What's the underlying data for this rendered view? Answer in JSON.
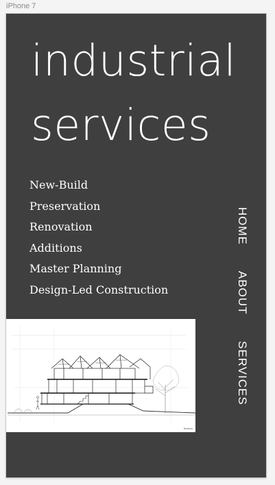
{
  "artboard": {
    "label": "iPhone 7"
  },
  "hero": {
    "line1": "industrial",
    "line2": "services"
  },
  "services": [
    "New-Build",
    "Preservation",
    "Renovation",
    "Additions",
    "Master Planning",
    "Design-Led Construction"
  ],
  "nav": {
    "home": "HOME",
    "about": "ABOUT",
    "services": "SERVICES"
  },
  "image": {
    "caption": "Section"
  },
  "colors": {
    "background": "#3f3f3f",
    "text": "#ffffff",
    "canvas": "#f4f4f4"
  }
}
